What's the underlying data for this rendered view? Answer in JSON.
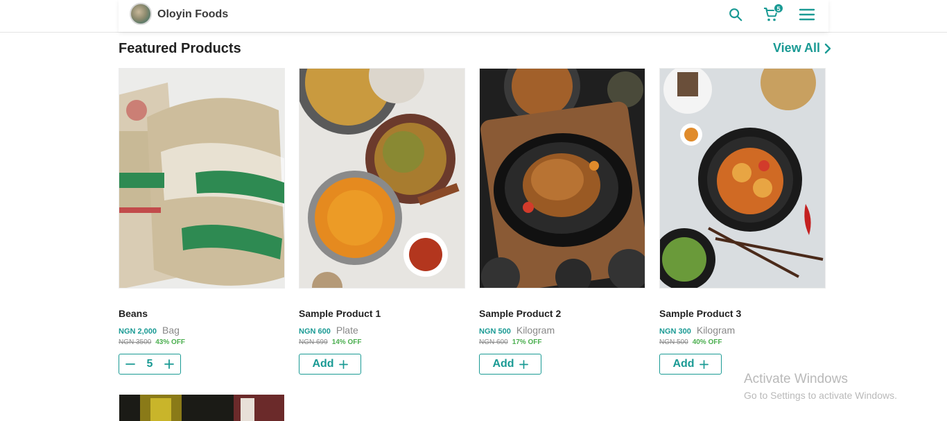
{
  "header": {
    "brand": "Oloyin Foods",
    "cart_count": "5",
    "icons": [
      "search-icon",
      "cart-icon",
      "menu-icon"
    ]
  },
  "section": {
    "title": "Featured Products",
    "view_all": "View All"
  },
  "products": [
    {
      "name": "Beans",
      "price": "NGN 2,000",
      "unit": "Bag",
      "old_price": "NGN 3500",
      "discount": "43% OFF",
      "quantity": "5",
      "in_cart": true
    },
    {
      "name": "Sample Product 1",
      "price": "NGN 600",
      "unit": "Plate",
      "old_price": "NGN 699",
      "discount": "14% OFF",
      "add_label": "Add",
      "in_cart": false
    },
    {
      "name": "Sample Product 2",
      "price": "NGN 500",
      "unit": "Kilogram",
      "old_price": "NGN 600",
      "discount": "17% OFF",
      "add_label": "Add",
      "in_cart": false
    },
    {
      "name": "Sample Product 3",
      "price": "NGN 300",
      "unit": "Kilogram",
      "old_price": "NGN 500",
      "discount": "40% OFF",
      "add_label": "Add",
      "in_cart": false
    }
  ],
  "watermark": {
    "line1": "Activate Windows",
    "line2": "Go to Settings to activate Windows."
  },
  "colors": {
    "accent": "#1a9a94",
    "discount": "#4caf50",
    "muted": "#888888"
  }
}
